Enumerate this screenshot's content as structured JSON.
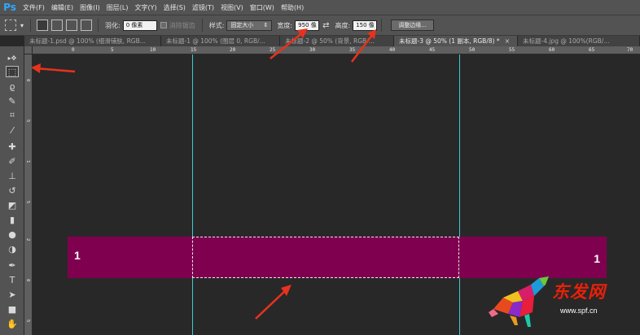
{
  "app": {
    "logo": "Ps"
  },
  "menu": {
    "items": [
      "文件(F)",
      "编辑(E)",
      "图像(I)",
      "图层(L)",
      "文字(Y)",
      "选择(S)",
      "滤镜(T)",
      "视图(V)",
      "窗口(W)",
      "帮助(H)"
    ]
  },
  "options": {
    "feather_label": "羽化:",
    "feather_value": "0 像素",
    "antialias_label": "消除锯齿",
    "style_label": "样式:",
    "style_value": "固定大小",
    "width_label": "宽度:",
    "width_value": "950 像",
    "height_label": "高度:",
    "height_value": "150 像",
    "refine_edge": "调整边缘..."
  },
  "tabs": [
    {
      "label": "未标题-1.psd @ 100% (细滑铺肤, RGB..."
    },
    {
      "label": "未标题-1 @ 100% (图层 0, RGB/..."
    },
    {
      "label": "未标题-2 @ 50% (背景, RGB/..."
    },
    {
      "label": "未标题-3 @ 50% (1 副本, RGB/8) *"
    },
    {
      "label": "未标题-4.jpg @ 100%(RGB/..."
    }
  ],
  "tab_close": "×",
  "ruler": {
    "top_ticks": [
      "0",
      "5",
      "10",
      "15",
      "20",
      "25",
      "30",
      "35",
      "40",
      "45",
      "50",
      "55",
      "60",
      "65",
      "70"
    ],
    "left_ticks": [
      "0",
      "5",
      "1",
      "5",
      "2",
      "0",
      "5"
    ]
  },
  "tools": [
    {
      "icon": "move-icon",
      "glyph": "▸✥"
    },
    {
      "icon": "rectangular-marquee-icon",
      "glyph": "⬚"
    },
    {
      "icon": "lasso-icon",
      "glyph": "ϱ"
    },
    {
      "icon": "quick-selection-icon",
      "glyph": "✎"
    },
    {
      "icon": "crop-icon",
      "glyph": "⌗"
    },
    {
      "icon": "eyedropper-icon",
      "glyph": "⁄"
    },
    {
      "icon": "healing-brush-icon",
      "glyph": "✚"
    },
    {
      "icon": "brush-icon",
      "glyph": "✐"
    },
    {
      "icon": "clone-stamp-icon",
      "glyph": "⊥"
    },
    {
      "icon": "history-brush-icon",
      "glyph": "↺"
    },
    {
      "icon": "eraser-icon",
      "glyph": "◩"
    },
    {
      "icon": "gradient-icon",
      "glyph": "▮"
    },
    {
      "icon": "blur-icon",
      "glyph": "●"
    },
    {
      "icon": "dodge-icon",
      "glyph": "◑"
    },
    {
      "icon": "pen-icon",
      "glyph": "✒"
    },
    {
      "icon": "type-icon",
      "glyph": "T"
    },
    {
      "icon": "path-selection-icon",
      "glyph": "➤"
    },
    {
      "icon": "rectangle-shape-icon",
      "glyph": "■"
    },
    {
      "icon": "hand-icon",
      "glyph": "✋"
    }
  ],
  "canvas": {
    "banner_left_label": "1",
    "banner_right_label": "1",
    "banner_color": "#800050",
    "guide_color": "#3fc8d0"
  },
  "annotation_color": "#e8321e",
  "watermark": {
    "brand": "东发网",
    "url": "www.spf.cn"
  }
}
